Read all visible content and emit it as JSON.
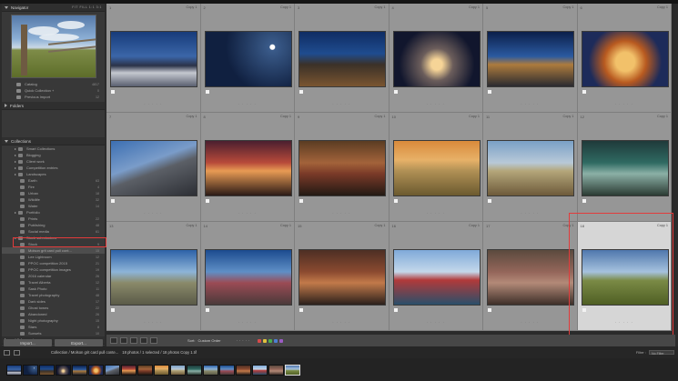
{
  "navigator": {
    "title": "Navigator",
    "options": "FIT  FILL  1:1  3:1"
  },
  "catalog_rows": [
    {
      "label": "Catalog",
      "count": "4817"
    },
    {
      "label": "Quick Collection +",
      "count": "0"
    },
    {
      "label": "Previous Import",
      "count": "12"
    }
  ],
  "folders_header": "Folders",
  "collections_header": "Collections",
  "collections": [
    {
      "label": "Smart Collections",
      "count": ""
    },
    {
      "label": "Blogging",
      "count": ""
    },
    {
      "label": "Client work",
      "count": ""
    },
    {
      "label": "Competition entries",
      "count": ""
    },
    {
      "label": "Landscapes",
      "count": ""
    },
    {
      "label": "Earth",
      "count": "63"
    },
    {
      "label": "Fire",
      "count": "4"
    },
    {
      "label": "Urban",
      "count": "18"
    },
    {
      "label": "Wildlife",
      "count": "32"
    },
    {
      "label": "Water",
      "count": "14"
    },
    {
      "label": "Portfolio",
      "count": ""
    },
    {
      "label": "Prints",
      "count": "22"
    },
    {
      "label": "Publishing",
      "count": "48"
    },
    {
      "label": "Social media",
      "count": "61"
    },
    {
      "label": "Stock submissions",
      "count": ""
    },
    {
      "label": "Stock",
      "count": "9"
    },
    {
      "label": "Molson grit card pull cont...",
      "count": "15"
    },
    {
      "label": "Lee Lightroom",
      "count": "12"
    },
    {
      "label": "PPOC competition 2015",
      "count": "21"
    },
    {
      "label": "PPOC competition images",
      "count": "19"
    },
    {
      "label": "2016 calendar",
      "count": "26"
    },
    {
      "label": "Travel Alberta",
      "count": "12"
    },
    {
      "label": "Sask Photo",
      "count": "11"
    },
    {
      "label": "Travel photography",
      "count": "48"
    },
    {
      "label": "Dark sides",
      "count": "17"
    },
    {
      "label": "Ghost towns",
      "count": "22"
    },
    {
      "label": "Abandoned",
      "count": "26"
    },
    {
      "label": "Night photography",
      "count": "15"
    },
    {
      "label": "Stars",
      "count": "8"
    },
    {
      "label": "Sunsets",
      "count": "10"
    }
  ],
  "publish_label": "Publish Services",
  "buttons": {
    "import": "Import...",
    "export": "Export..."
  },
  "grid": [
    {
      "idx": "1",
      "copy": "Copy 1"
    },
    {
      "idx": "2",
      "copy": "Copy 1"
    },
    {
      "idx": "3",
      "copy": "Copy 1"
    },
    {
      "idx": "4",
      "copy": "Copy 1"
    },
    {
      "idx": "5",
      "copy": "Copy 1"
    },
    {
      "idx": "6",
      "copy": "Copy 1"
    },
    {
      "idx": "7",
      "copy": "Copy 1"
    },
    {
      "idx": "8",
      "copy": "Copy 1"
    },
    {
      "idx": "9",
      "copy": "Copy 1"
    },
    {
      "idx": "10",
      "copy": "Copy 1"
    },
    {
      "idx": "11",
      "copy": "Copy 1"
    },
    {
      "idx": "12",
      "copy": "Copy 1"
    },
    {
      "idx": "13",
      "copy": "Copy 1"
    },
    {
      "idx": "14",
      "copy": "Copy 1"
    },
    {
      "idx": "15",
      "copy": "Copy 1"
    },
    {
      "idx": "16",
      "copy": "Copy 1"
    },
    {
      "idx": "17",
      "copy": "Copy 1"
    },
    {
      "idx": "18",
      "copy": "Copy 1"
    }
  ],
  "toolbar": {
    "sort_label": "Sort:",
    "sort_value": "Custom Order"
  },
  "status": {
    "path": "Collection / Molson grit card pull conte...",
    "info": "18 photos / 1 selected / 18 photos Copy 1.tif",
    "filter_label": "Filter :",
    "filter_value": "No Filter"
  },
  "colors": {
    "selection_outline": "#e23b3b"
  }
}
